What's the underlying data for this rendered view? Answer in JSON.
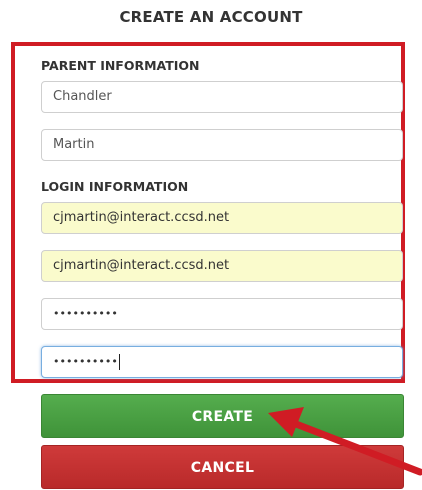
{
  "page": {
    "title": "CREATE AN ACCOUNT"
  },
  "parent_section": {
    "label": "PARENT INFORMATION",
    "first_name": "Chandler",
    "last_name": "Martin"
  },
  "login_section": {
    "label": "LOGIN INFORMATION",
    "email": "cjmartin@interact.ccsd.net",
    "email_confirm": "cjmartin@interact.ccsd.net",
    "password_mask": "••••••••••",
    "password_confirm_mask": "••••••••••"
  },
  "buttons": {
    "create": "CREATE",
    "cancel": "CANCEL"
  },
  "colors": {
    "highlight_border": "#d01c24",
    "create_button": "#4aa043",
    "cancel_button": "#c43131",
    "autofill_background": "#fafbcc",
    "annotation_arrow": "#d01c24"
  },
  "icons": {
    "annotation": "red-arrow-icon"
  }
}
